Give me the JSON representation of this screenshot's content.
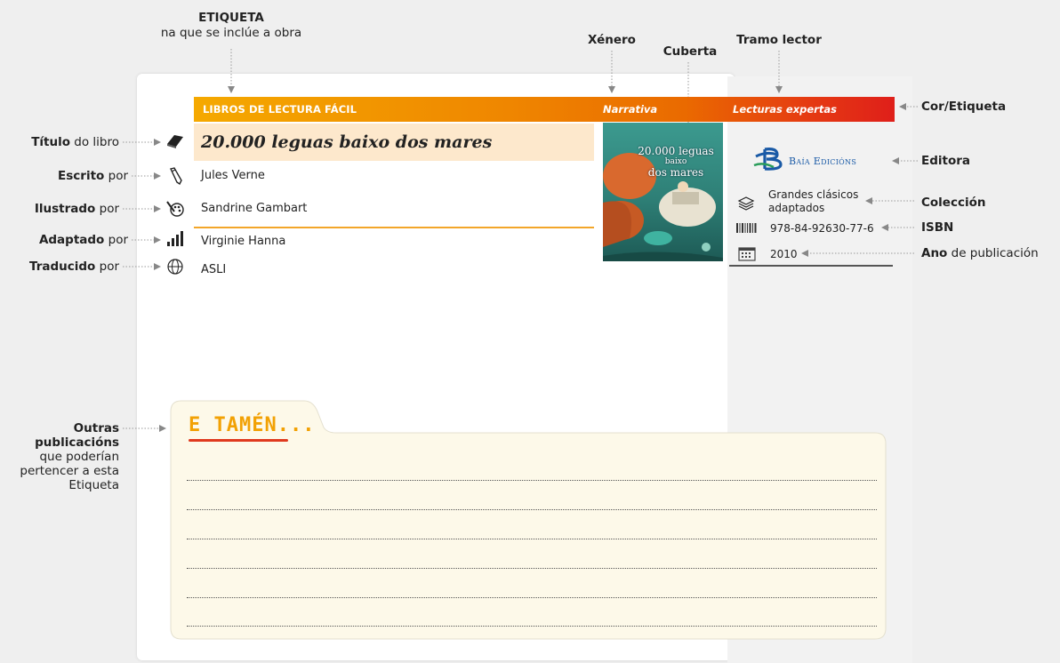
{
  "annotations": {
    "top_label_bold": "ETIQUETA",
    "top_label_sub": "na que se inclúe a obra",
    "genre": "Xénero",
    "cover": "Cuberta",
    "reading_stage": "Tramo lector",
    "color_tag": "Cor/Etiqueta",
    "publisher": "Editora",
    "collection": "Colección",
    "isbn": "ISBN",
    "year_bold": "Ano",
    "year_rest": " de publicación",
    "left": [
      {
        "bold": "Título",
        "rest": " do libro"
      },
      {
        "bold": "Escrito",
        "rest": " por"
      },
      {
        "bold": "Ilustrado",
        "rest": " por"
      },
      {
        "bold": "Adaptado",
        "rest": " por"
      },
      {
        "bold": "Traducido",
        "rest": " por"
      }
    ],
    "other_bold_1": "Outras",
    "other_bold_2": "publicacións",
    "other_rest_1": "que poderían",
    "other_rest_2": "pertencer a esta",
    "other_rest_3": "Etiqueta"
  },
  "band": {
    "label": "LIBROS DE LECTURA FÁCIL",
    "genre": "Narrativa",
    "stage": "Lecturas expertas",
    "colors": [
      "#f5a900",
      "#ea6a00",
      "#df1f1a"
    ]
  },
  "book": {
    "title": "20.000 leguas baixo dos mares",
    "author": "Jules Verne",
    "illustrator": "Sandrine Gambart",
    "adapter": "Virginie Hanna",
    "translator": "ASLI"
  },
  "cover_text": {
    "line1": "20.000 leguas",
    "line2": "baixo",
    "line3": "dos mares"
  },
  "side": {
    "publisher_logo_text": "Baía Edicións",
    "collection_1": "Grandes clásicos",
    "collection_2": "adaptados",
    "isbn": "978-84-92630-77-6",
    "year": "2010"
  },
  "also_title": "E TAMÉN..."
}
